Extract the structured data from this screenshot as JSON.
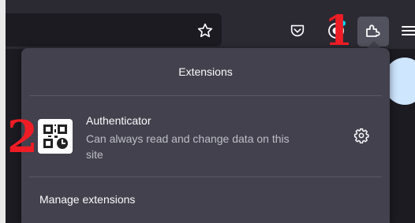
{
  "colors": {
    "toolbar": "#2b2a33",
    "panel": "#42414d",
    "annotation": "#ee1c24",
    "active_button": "#52525e"
  },
  "toolbar": {
    "icons": [
      "star-icon",
      "pocket-icon",
      "extension-badge-icon",
      "puzzle-icon",
      "hamburger-menu-icon"
    ]
  },
  "annotations": {
    "step1": "1",
    "step2": "2"
  },
  "panel": {
    "title": "Extensions",
    "extension": {
      "name": "Authenticator",
      "description": "Can always read and change data on this site",
      "icon": "qr-code-icon",
      "settings_icon": "gear-icon"
    },
    "manage_label": "Manage extensions"
  }
}
